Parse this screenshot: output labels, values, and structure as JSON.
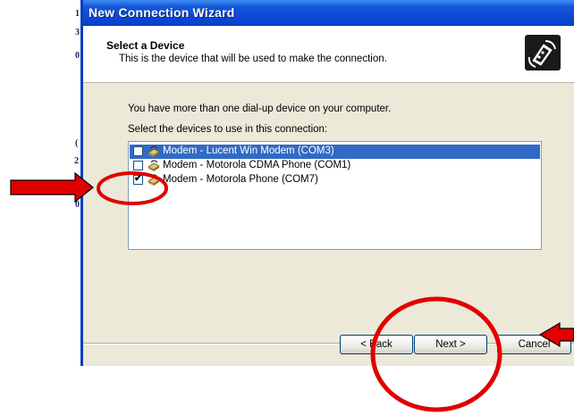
{
  "background_fragments": [
    "1",
    "3",
    "0",
    "(",
    "2",
    "0"
  ],
  "window": {
    "title": "New Connection Wizard",
    "header_title": "Select a Device",
    "header_subtitle": "This is the device that will be used to make the connection.",
    "header_icon": "modem-wizard-icon"
  },
  "content": {
    "intro": "You have more than one dial-up device on your computer.",
    "instruction": "Select the devices to use in this connection:",
    "devices": [
      {
        "label": "Modem - Lucent Win Modem (COM3)",
        "checked": false,
        "selected": true
      },
      {
        "label": "Modem - Motorola CDMA Phone (COM1)",
        "checked": false,
        "selected": false
      },
      {
        "label": "Modem - Motorola Phone (COM7)",
        "checked": true,
        "selected": false
      }
    ]
  },
  "buttons": {
    "back": "< Back",
    "next": "Next >",
    "cancel": "Cancel"
  },
  "annotations": {
    "color": "#e00000",
    "arrows": [
      "arrow-pointing-right",
      "arrow-pointing-left"
    ],
    "circles": [
      "checkbox-highlight",
      "next-button-highlight"
    ]
  },
  "colors": {
    "titlebar": "#0b47d3",
    "selection": "#316ac5",
    "dialog_bg": "#ece9d8"
  }
}
